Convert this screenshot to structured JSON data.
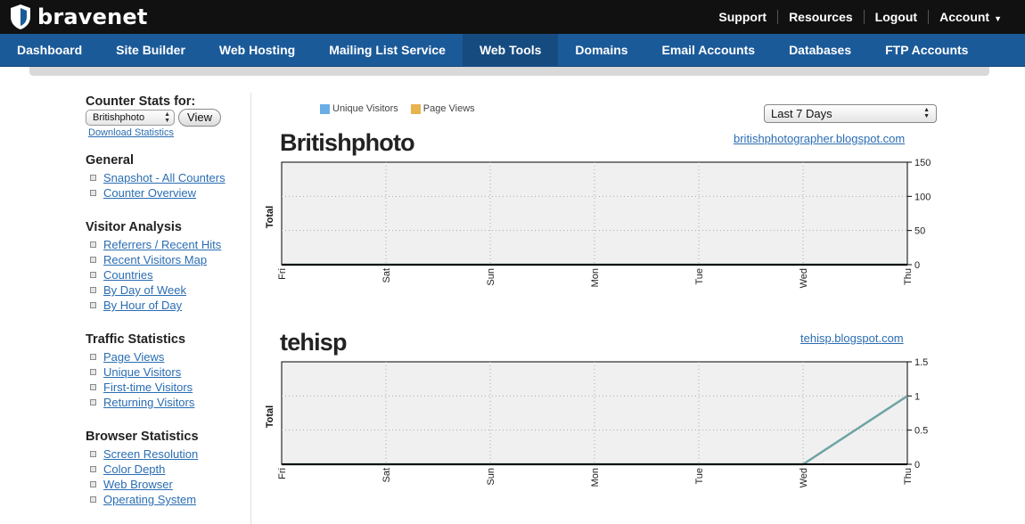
{
  "brand": {
    "name": "bravenet"
  },
  "top_links": {
    "support": "Support",
    "resources": "Resources",
    "logout": "Logout",
    "account": "Account"
  },
  "nav": {
    "items": [
      {
        "label": "Dashboard"
      },
      {
        "label": "Site Builder"
      },
      {
        "label": "Web Hosting"
      },
      {
        "label": "Mailing List Service"
      },
      {
        "label": "Web Tools",
        "active": true
      },
      {
        "label": "Domains"
      },
      {
        "label": "Email Accounts"
      },
      {
        "label": "Databases"
      },
      {
        "label": "FTP Accounts"
      }
    ]
  },
  "sidebar": {
    "counter_heading": "Counter Stats for:",
    "selected_counter": "Britishphoto",
    "view_label": "View",
    "download_label": "Download Statistics",
    "sections": [
      {
        "title": "General",
        "links": [
          "Snapshot - All Counters",
          "Counter Overview"
        ]
      },
      {
        "title": "Visitor Analysis",
        "links": [
          "Referrers / Recent Hits",
          "Recent Visitors Map",
          "Countries",
          "By Day of Week",
          "By Hour of Day"
        ]
      },
      {
        "title": "Traffic Statistics",
        "links": [
          "Page Views",
          "Unique Visitors",
          "First-time Visitors",
          "Returning Visitors"
        ]
      },
      {
        "title": "Browser Statistics",
        "links": [
          "Screen Resolution",
          "Color Depth",
          "Web Browser",
          "Operating System"
        ]
      }
    ]
  },
  "legend": {
    "unique_visitors": "Unique Visitors",
    "page_views": "Page Views"
  },
  "range": {
    "selected": "Last 7 Days"
  },
  "counters": [
    {
      "name": "Britishphoto",
      "url": "britishphotographer.blogspot.com"
    },
    {
      "name": "tehisp",
      "url": "tehisp.blogspot.com"
    }
  ],
  "colors": {
    "topbar": "#111111",
    "nav": "#1b5a99",
    "nav_active": "#164b80",
    "link": "#2a6db3",
    "unique_visitors": "#6aaee8",
    "page_views": "#e8b24e",
    "series_line": "#6fa3a3",
    "plot_bg": "#f0f0f0"
  },
  "chart_data": [
    {
      "type": "line",
      "ylabel": "Total",
      "categories": [
        "Fri",
        "Sat",
        "Sun",
        "Mon",
        "Tue",
        "Wed",
        "Thu"
      ],
      "yticks": [
        "150",
        "100",
        "50",
        "0"
      ],
      "ylim": [
        0,
        150
      ],
      "grid": true,
      "series": [
        {
          "values": [
            0,
            0,
            0,
            0,
            0,
            0,
            0
          ]
        }
      ]
    },
    {
      "type": "line",
      "ylabel": "Total",
      "categories": [
        "Fri",
        "Sat",
        "Sun",
        "Mon",
        "Tue",
        "Wed",
        "Thu"
      ],
      "yticks": [
        "1.5",
        "1",
        "0.5",
        "0"
      ],
      "ylim": [
        0,
        1.5
      ],
      "grid": true,
      "series": [
        {
          "values": [
            0,
            0,
            0,
            0,
            0,
            0,
            1
          ]
        }
      ]
    }
  ]
}
